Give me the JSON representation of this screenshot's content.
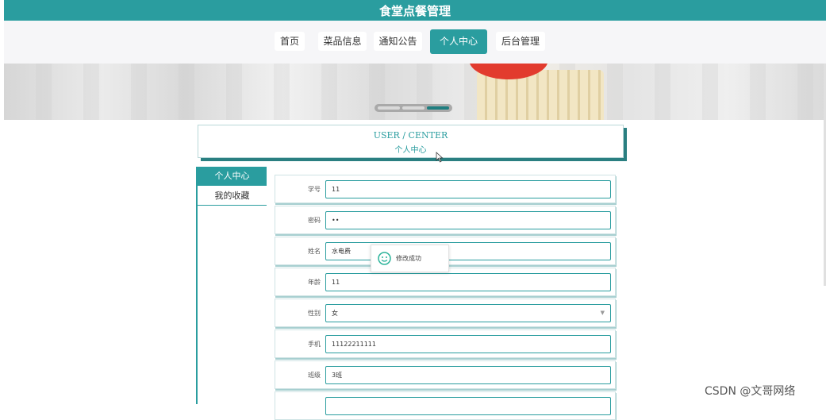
{
  "app": {
    "title": "食堂点餐管理"
  },
  "nav": {
    "items": [
      {
        "label": "首页",
        "active": false
      },
      {
        "label": "菜品信息",
        "active": false
      },
      {
        "label": "通知公告",
        "active": false
      },
      {
        "label": "个人中心",
        "active": true
      },
      {
        "label": "后台管理",
        "active": false
      }
    ]
  },
  "banner": {
    "slide_count": 3,
    "active_slide": 3
  },
  "center": {
    "title_en": "USER / CENTER",
    "title_cn": "个人中心"
  },
  "sidebar": {
    "items": [
      {
        "label": "个人中心",
        "active": true
      },
      {
        "label": "我的收藏",
        "active": false
      }
    ]
  },
  "form": {
    "fields": [
      {
        "label": "学号",
        "value": "11"
      },
      {
        "label": "密码",
        "value": "••"
      },
      {
        "label": "姓名",
        "value": "水电费"
      },
      {
        "label": "年龄",
        "value": "11"
      },
      {
        "label": "性别",
        "value": "女",
        "type": "select"
      },
      {
        "label": "手机",
        "value": "11122211111"
      },
      {
        "label": "班级",
        "value": "3班"
      }
    ]
  },
  "toast": {
    "message": "修改成功",
    "icon": "smile-icon"
  },
  "watermark": "CSDN @文哥网络",
  "colors": {
    "accent": "#2a9d9f",
    "accent_dark": "#2a7f81"
  }
}
